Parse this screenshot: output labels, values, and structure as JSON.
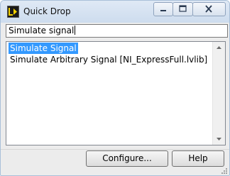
{
  "window": {
    "title": "Quick Drop",
    "icon": "labview-app-icon",
    "controls": [
      "minimize-icon",
      "maximize-icon",
      "close-icon"
    ]
  },
  "search": {
    "value": "Simulate signal"
  },
  "results": {
    "items": [
      {
        "label": "Simulate Signal",
        "selected": true
      },
      {
        "label": "Simulate Arbitrary Signal [NI_ExpressFull.lvlib]",
        "selected": false
      }
    ]
  },
  "buttons": {
    "configure_label": "Configure...",
    "help_label": "Help"
  },
  "colors": {
    "selection": "#3399ff",
    "titlebar": "#dfe9f5",
    "close_hover": "#c9483a"
  }
}
